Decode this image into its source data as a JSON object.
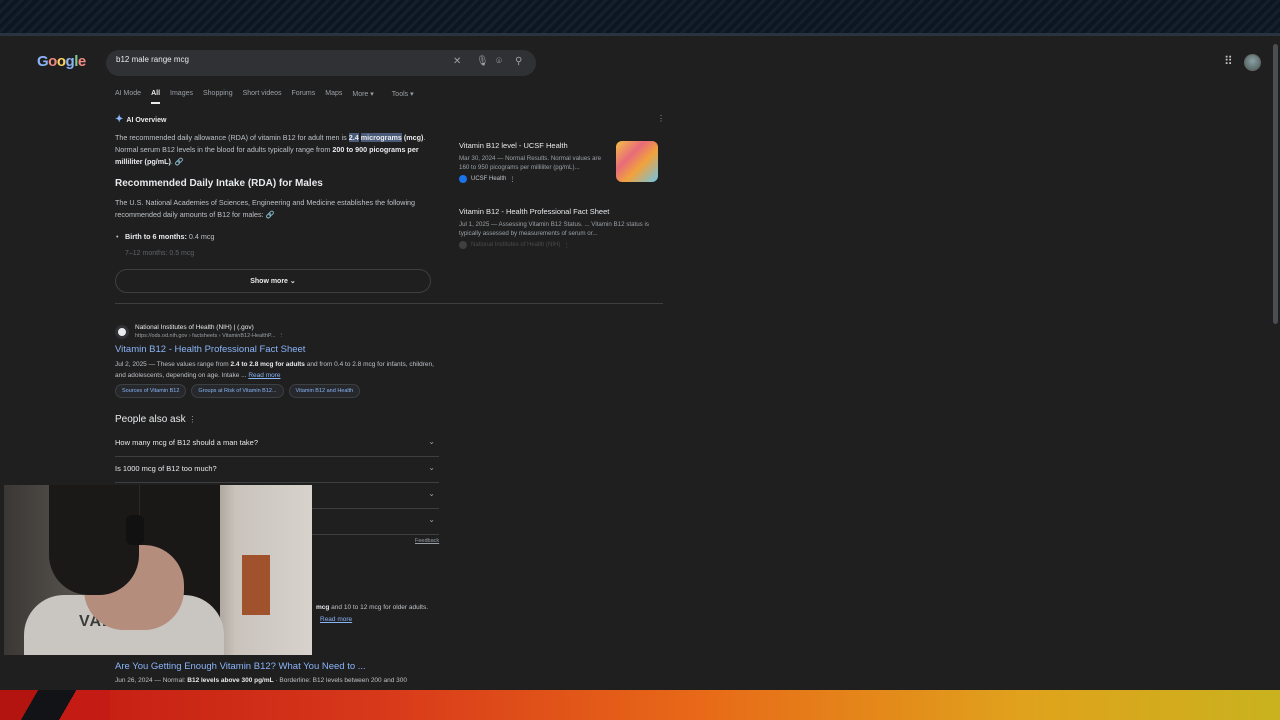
{
  "google": {
    "logo": "Google"
  },
  "search": {
    "query": "b12 male range mcg"
  },
  "icons": {
    "clear": "close-icon",
    "mic": "microphone-icon",
    "lens": "camera-icon",
    "search": "search-icon",
    "apps": "apps-grid-icon"
  },
  "tabs": [
    "AI Mode",
    "All",
    "Images",
    "Shopping",
    "Short videos",
    "Forums",
    "Maps",
    "More",
    "Tools"
  ],
  "ai_overview": {
    "label": "AI Overview",
    "intro_pre": "The recommended daily allowance (RDA) of vitamin B12 for adult men is ",
    "intro_hl1": "2.4",
    "intro_hl2": "micrograms",
    "intro_bold1": " (mcg)",
    "intro_mid": ". Normal serum B12 levels in the blood for adults typically range from ",
    "intro_bold2": "200 to 900 picograms per milliliter (pg/mL)",
    "intro_end": ".",
    "heading": "Recommended Daily Intake (RDA) for Males",
    "body": "The U.S. National Academies of Sciences, Engineering and Medicine establishes the following recommended daily amounts of B12 for males:",
    "bullet_label": "Birth to 6 months:",
    "bullet_value": " 0.4 mcg",
    "faded": "7–12 months: 0.5 mcg",
    "show_more": "Show more"
  },
  "sources": [
    {
      "title": "Vitamin B12 level - UCSF Health",
      "snippet": "Mar 30, 2024 — Normal Results. Normal values are 160 to 950 picograms per milliliter (pg/mL)...",
      "site": "UCSF Health"
    },
    {
      "title": "Vitamin B12 - Health Professional Fact Sheet",
      "snippet": "Jul 1, 2025 — Assessing Vitamin B12 Status. ... Vitamin B12 status is typically assessed by measurements of serum or...",
      "site": "National Institutes of Health (NIH)"
    }
  ],
  "result1": {
    "site": "National Institutes of Health (NIH) | (.gov)",
    "url": "https://ods.od.nih.gov › factsheets › VitaminB12-HealthP...",
    "title": "Vitamin B12 - Health Professional Fact Sheet",
    "snip_date": "Jul 2, 2025 — These values range from ",
    "snip_bold": "2.4 to 2.8 mcg for adults",
    "snip_rest": " and from 0.4 to 2.8 mcg for infants, children, and adolescents, depending on age. Intake ... ",
    "read_more": "Read more",
    "chips": [
      "Sources of Vitamin B12",
      "Groups at Risk of Vitamin B12...",
      "Vitamin B12 and Health"
    ]
  },
  "paa": {
    "title": "People also ask",
    "questions": [
      "How many mcg of B12 should a man take?",
      "Is 1000 mcg of B12 too much?",
      "",
      ""
    ],
    "feedback": "Feedback"
  },
  "partial": {
    "bold": "mcg",
    "rest": " and 10 to 12 mcg for older adults.",
    "read_more": "Read more"
  },
  "result2": {
    "url": "https://www.jasonmachine.org › ...are-you-getting...",
    "title": "Are You Getting Enough Vitamin B12? What You Need to ...",
    "snip_date": "Jun 26, 2024 — Normal: ",
    "snip_bold": "B12 levels above 300 pg/mL",
    "snip_rest": " · Borderline: B12 levels between 200 and 300"
  },
  "webcam": {
    "shirt_text": "VALIANT"
  }
}
